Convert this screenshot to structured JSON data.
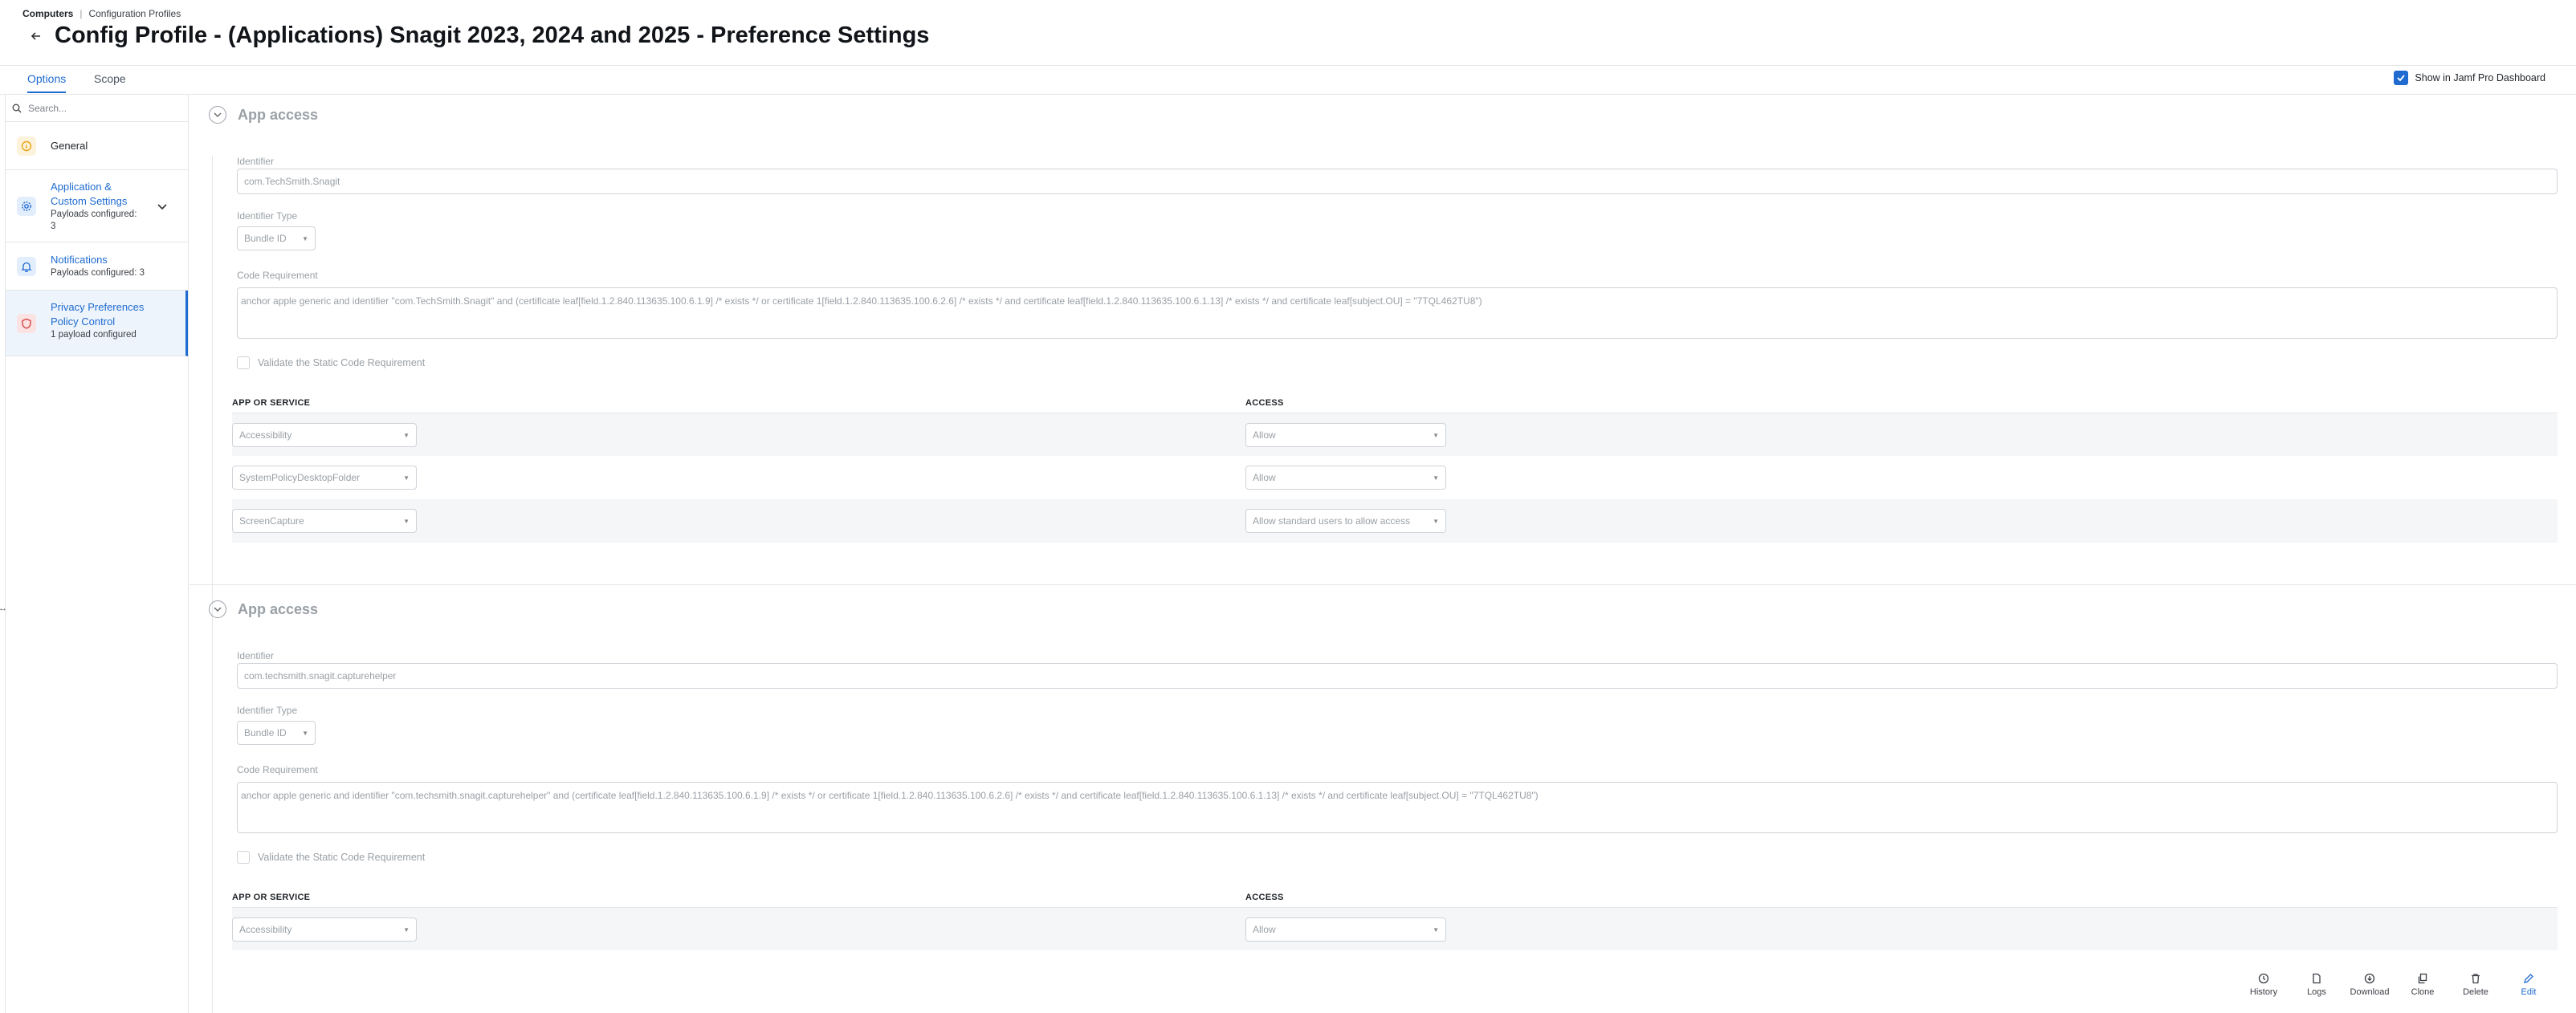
{
  "breadcrumb": {
    "root": "Computers",
    "separator": "|",
    "current": "Configuration Profiles"
  },
  "page_title": "Config Profile - (Applications) Snagit 2023, 2024 and 2025 - Preference Settings",
  "tabs": [
    {
      "label": "Options",
      "active": true
    },
    {
      "label": "Scope",
      "active": false
    }
  ],
  "show_dashboard": {
    "label": "Show in Jamf Pro Dashboard",
    "checked": true
  },
  "search": {
    "placeholder": "Search..."
  },
  "sidebar": {
    "items": [
      {
        "label": "General",
        "sub": "",
        "icon": "info-icon",
        "color": "#e8a317"
      },
      {
        "label": "Application & Custom Settings",
        "sub": "Payloads configured: 3",
        "icon": "gear-icon",
        "color": "#1f6bd0"
      },
      {
        "label": "Notifications",
        "sub": "Payloads configured: 3",
        "icon": "bell-icon",
        "color": "#1f6bd0"
      },
      {
        "label": "Privacy Preferences Policy Control",
        "sub": "1 payload configured",
        "icon": "shield-icon",
        "color": "#d64545"
      }
    ]
  },
  "sections": [
    {
      "title": "App access",
      "identifier_label": "Identifier",
      "identifier": "com.TechSmith.Snagit",
      "identifier_type_label": "Identifier Type",
      "identifier_type": "Bundle ID",
      "code_req_label": "Code Requirement",
      "code_requirement": "anchor apple generic and identifier \"com.TechSmith.Snagit\" and (certificate leaf[field.1.2.840.113635.100.6.1.9] /* exists */ or certificate 1[field.1.2.840.113635.100.6.2.6] /* exists */ and certificate leaf[field.1.2.840.113635.100.6.1.13] /* exists */ and certificate leaf[subject.OU] = \"7TQL462TU8\")",
      "validate_label": "Validate the Static Code Requirement",
      "col_service": "APP OR SERVICE",
      "col_access": "ACCESS",
      "rows": [
        {
          "service": "Accessibility",
          "access": "Allow"
        },
        {
          "service": "SystemPolicyDesktopFolder",
          "access": "Allow"
        },
        {
          "service": "ScreenCapture",
          "access": "Allow standard users to allow access"
        }
      ]
    },
    {
      "title": "App access",
      "identifier_label": "Identifier",
      "identifier": "com.techsmith.snagit.capturehelper",
      "identifier_type_label": "Identifier Type",
      "identifier_type": "Bundle ID",
      "code_req_label": "Code Requirement",
      "code_requirement": "anchor apple generic and identifier \"com.techsmith.snagit.capturehelper\" and (certificate leaf[field.1.2.840.113635.100.6.1.9] /* exists */ or certificate 1[field.1.2.840.113635.100.6.2.6] /* exists */ and certificate leaf[field.1.2.840.113635.100.6.1.13] /* exists */ and certificate leaf[subject.OU] = \"7TQL462TU8\")",
      "validate_label": "Validate the Static Code Requirement",
      "col_service": "APP OR SERVICE",
      "col_access": "ACCESS",
      "rows": [
        {
          "service": "Accessibility",
          "access": "Allow"
        }
      ]
    }
  ],
  "toolbar": {
    "history": "History",
    "logs": "Logs",
    "download": "Download",
    "clone": "Clone",
    "delete": "Delete",
    "edit": "Edit"
  }
}
